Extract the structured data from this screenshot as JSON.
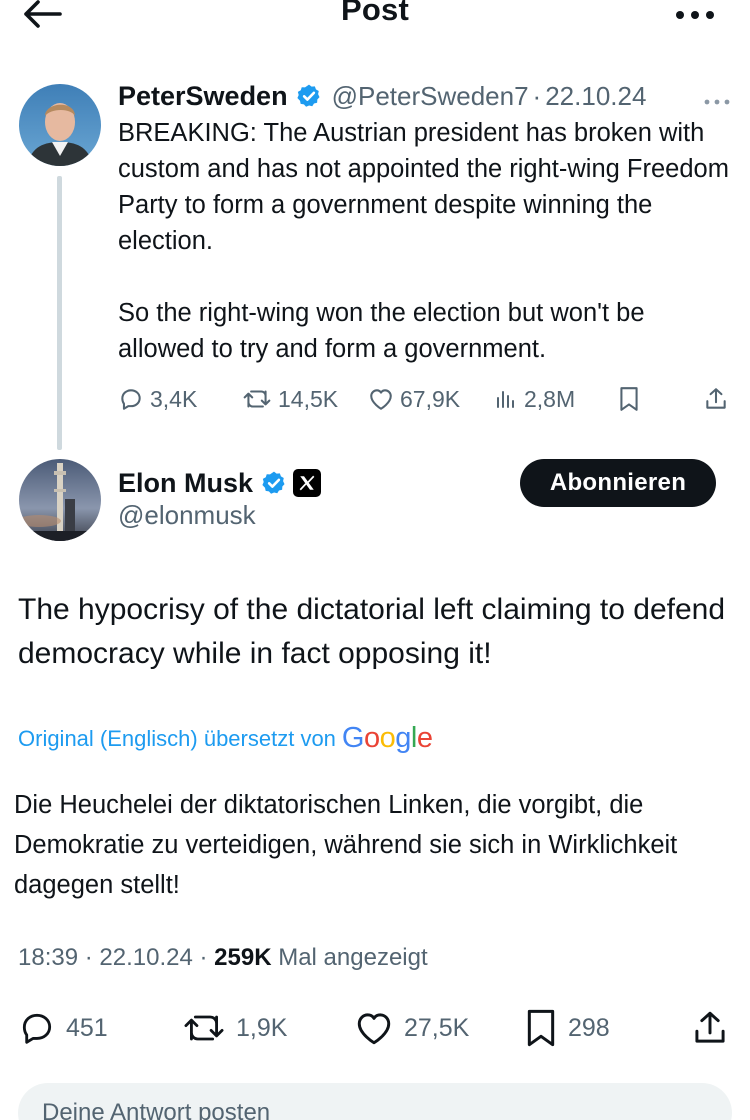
{
  "header": {
    "title": "Post",
    "back_icon": "arrow-left-icon",
    "more_icon": "more-horizontal-icon"
  },
  "parent_tweet": {
    "name": "PeterSweden",
    "handle": "@PeterSweden7",
    "separator": "·",
    "date": "22.10.24",
    "text_paragraphs": [
      "BREAKING: The Austrian president has broken with custom and has not appointed the right-wing Freedom Party to form a government despite winning the election.",
      "So the right-wing won the election but won't be allowed to try and form a government."
    ],
    "actions": {
      "replies": "3,4K",
      "reposts": "14,5K",
      "likes": "67,9K",
      "views": "2,8M"
    }
  },
  "main_tweet": {
    "name": "Elon Musk",
    "handle": "@elonmusk",
    "follow_label": "Abonnieren",
    "text": "The hypocrisy of the dictatorial left claiming to defend democracy while in fact opposing it!",
    "translation_label": "Original (Englisch) übersetzt von",
    "translation_provider": "Google",
    "translated_text": "Die Heuchelei der diktatorischen Linken, die vorgibt, die Demokratie zu verteidigen, während sie sich in Wirklichkeit dagegen stellt!",
    "time": "18:39",
    "separator": "·",
    "date": "22.10.24",
    "views_count": "259K",
    "views_label": "Mal angezeigt",
    "actions": {
      "replies": "451",
      "reposts": "1,9K",
      "likes": "27,5K",
      "bookmarks": "298"
    }
  },
  "reply": {
    "placeholder": "Deine Antwort posten"
  },
  "colors": {
    "text": "#0f1419",
    "secondary": "#536471",
    "link": "#1d9bf0",
    "verified": "#1d9bf0"
  }
}
